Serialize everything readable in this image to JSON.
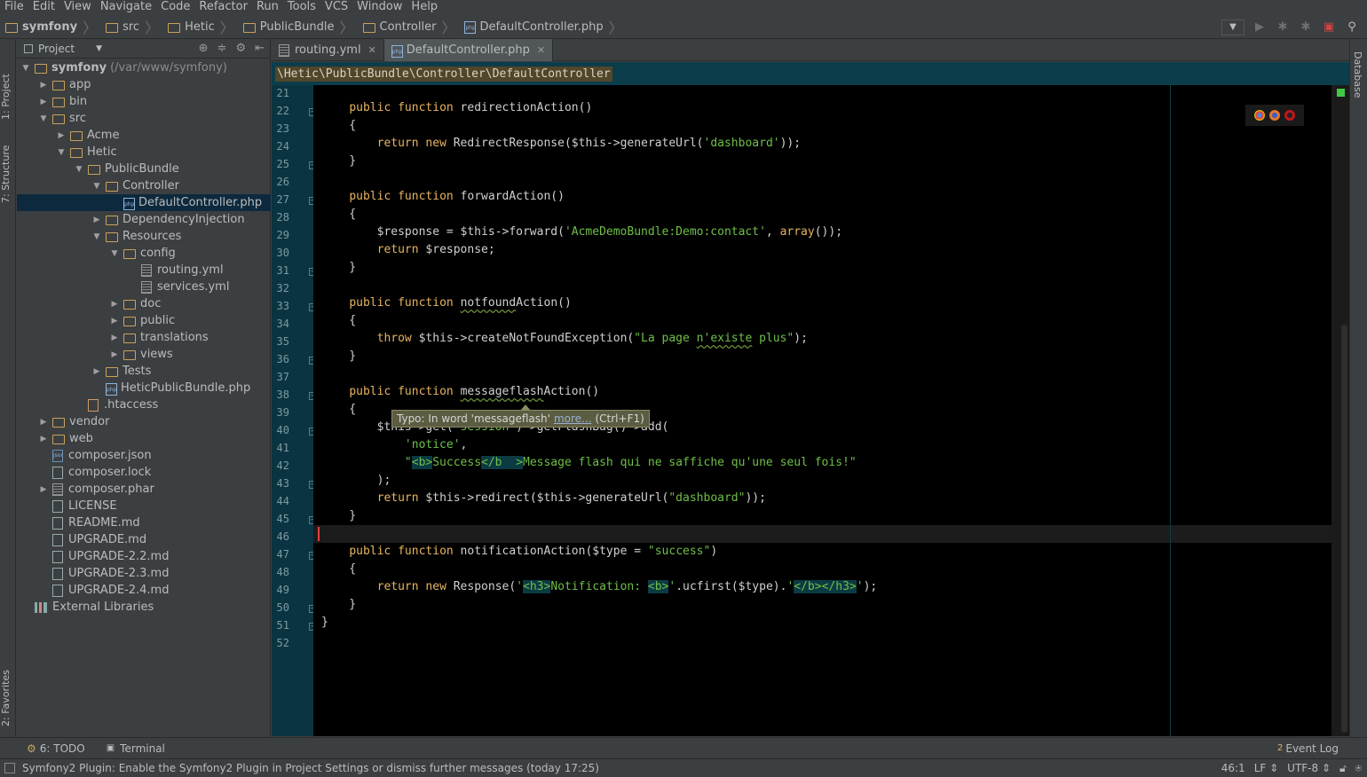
{
  "menu": [
    "File",
    "Edit",
    "View",
    "Navigate",
    "Code",
    "Refactor",
    "Run",
    "Tools",
    "VCS",
    "Window",
    "Help"
  ],
  "navbar": {
    "crumbs": [
      "symfony",
      "src",
      "Hetic",
      "PublicBundle",
      "Controller",
      "DefaultController.php"
    ]
  },
  "left_tool_tabs": {
    "project": "1: Project",
    "structure": "7: Structure",
    "favorites": "2: Favorites"
  },
  "project_panel": {
    "title": "Project",
    "tree": [
      {
        "label": "symfony",
        "suffix": "(/var/www/symfony)",
        "level": 0,
        "type": "folder",
        "arrow": "down",
        "bold": true
      },
      {
        "label": "app",
        "level": 1,
        "type": "folder",
        "arrow": "right"
      },
      {
        "label": "bin",
        "level": 1,
        "type": "folder",
        "arrow": "right"
      },
      {
        "label": "src",
        "level": 1,
        "type": "folder",
        "arrow": "down"
      },
      {
        "label": "Acme",
        "level": 2,
        "type": "folder",
        "arrow": "right"
      },
      {
        "label": "Hetic",
        "level": 2,
        "type": "folder",
        "arrow": "down"
      },
      {
        "label": "PublicBundle",
        "level": 3,
        "type": "folder",
        "arrow": "down"
      },
      {
        "label": "Controller",
        "level": 4,
        "type": "folder",
        "arrow": "down"
      },
      {
        "label": "DefaultController.php",
        "level": 5,
        "type": "php",
        "arrow": "none",
        "selected": true
      },
      {
        "label": "DependencyInjection",
        "level": 4,
        "type": "folder",
        "arrow": "right"
      },
      {
        "label": "Resources",
        "level": 4,
        "type": "folder",
        "arrow": "down"
      },
      {
        "label": "config",
        "level": 5,
        "type": "folder",
        "arrow": "down"
      },
      {
        "label": "routing.yml",
        "level": 6,
        "type": "yml",
        "arrow": "none"
      },
      {
        "label": "services.yml",
        "level": 6,
        "type": "yml",
        "arrow": "none"
      },
      {
        "label": "doc",
        "level": 5,
        "type": "folder",
        "arrow": "right"
      },
      {
        "label": "public",
        "level": 5,
        "type": "folder",
        "arrow": "right"
      },
      {
        "label": "translations",
        "level": 5,
        "type": "folder",
        "arrow": "right"
      },
      {
        "label": "views",
        "level": 5,
        "type": "folder",
        "arrow": "right"
      },
      {
        "label": "Tests",
        "level": 4,
        "type": "folder",
        "arrow": "right"
      },
      {
        "label": "HeticPublicBundle.php",
        "level": 4,
        "type": "php",
        "arrow": "none"
      },
      {
        "label": ".htaccess",
        "level": 3,
        "type": "htaccess",
        "arrow": "none"
      },
      {
        "label": "vendor",
        "level": 1,
        "type": "folder",
        "arrow": "right"
      },
      {
        "label": "web",
        "level": 1,
        "type": "folder",
        "arrow": "right"
      },
      {
        "label": "composer.json",
        "level": 1,
        "type": "json",
        "arrow": "none"
      },
      {
        "label": "composer.lock",
        "level": 1,
        "type": "file",
        "arrow": "none"
      },
      {
        "label": "composer.phar",
        "level": 1,
        "type": "yml",
        "arrow": "right"
      },
      {
        "label": "LICENSE",
        "level": 1,
        "type": "file",
        "arrow": "none"
      },
      {
        "label": "README.md",
        "level": 1,
        "type": "file",
        "arrow": "none"
      },
      {
        "label": "UPGRADE.md",
        "level": 1,
        "type": "file",
        "arrow": "none"
      },
      {
        "label": "UPGRADE-2.2.md",
        "level": 1,
        "type": "file",
        "arrow": "none"
      },
      {
        "label": "UPGRADE-2.3.md",
        "level": 1,
        "type": "file",
        "arrow": "none"
      },
      {
        "label": "UPGRADE-2.4.md",
        "level": 1,
        "type": "file",
        "arrow": "none"
      },
      {
        "label": "External Libraries",
        "level": 0,
        "type": "lib",
        "arrow": "none"
      }
    ]
  },
  "editor_tabs": [
    {
      "label": "routing.yml",
      "active": false
    },
    {
      "label": "DefaultController.php",
      "active": true
    }
  ],
  "editor_breadcrumb": "\\Hetic\\PublicBundle\\Controller\\DefaultController",
  "code_lines": [
    {
      "n": 21,
      "t": ""
    },
    {
      "n": 22,
      "t": "    public function redirectionAction()"
    },
    {
      "n": 23,
      "t": "    {"
    },
    {
      "n": 24,
      "t": "        return new RedirectResponse($this->generateUrl('dashboard'));"
    },
    {
      "n": 25,
      "t": "    }"
    },
    {
      "n": 26,
      "t": ""
    },
    {
      "n": 27,
      "t": "    public function forwardAction()"
    },
    {
      "n": 28,
      "t": "    {"
    },
    {
      "n": 29,
      "t": "        $response = $this->forward('AcmeDemoBundle:Demo:contact', array());"
    },
    {
      "n": 30,
      "t": "        return $response;"
    },
    {
      "n": 31,
      "t": "    }"
    },
    {
      "n": 32,
      "t": ""
    },
    {
      "n": 33,
      "t": "    public function notfoundAction()"
    },
    {
      "n": 34,
      "t": "    {"
    },
    {
      "n": 35,
      "t": "        throw $this->createNotFoundException(\"La page n'existe plus\");"
    },
    {
      "n": 36,
      "t": "    }"
    },
    {
      "n": 37,
      "t": ""
    },
    {
      "n": 38,
      "t": "    public function messageflashAction()"
    },
    {
      "n": 39,
      "t": "    {"
    },
    {
      "n": 40,
      "t": "        $this->get('session')->getFlashBag()->add("
    },
    {
      "n": 41,
      "t": "            'notice',"
    },
    {
      "n": 42,
      "t": "            \"<b>Success</b  >Message flash qui ne saffiche qu'une seul fois!\""
    },
    {
      "n": 43,
      "t": "        );"
    },
    {
      "n": 44,
      "t": "        return $this->redirect($this->generateUrl(\"dashboard\"));"
    },
    {
      "n": 45,
      "t": "    }"
    },
    {
      "n": 46,
      "t": ""
    },
    {
      "n": 47,
      "t": "    public function notificationAction($type = \"success\")"
    },
    {
      "n": 48,
      "t": "    {"
    },
    {
      "n": 49,
      "t": "        return new Response('<h3>Notification: <b>'.ucfirst($type).'</b></h3>');"
    },
    {
      "n": 50,
      "t": "    }"
    },
    {
      "n": 51,
      "t": "}"
    },
    {
      "n": 52,
      "t": ""
    }
  ],
  "tooltip": {
    "prefix": "Typo: In word 'messageflash'",
    "link": "more...",
    "shortcut": "(Ctrl+F1)"
  },
  "right_tool_tab": "Database",
  "bottom_tools": {
    "todo": "6: TODO",
    "terminal": "Terminal",
    "event_log": "Event Log",
    "event_count": "2"
  },
  "status": {
    "message": "Symfony2 Plugin: Enable the Symfony2 Plugin in Project Settings or dismiss further messages (today 17:25)",
    "position": "46:1",
    "line_sep": "LF",
    "encoding": "UTF-8"
  },
  "colors": {
    "keyword": "#e6b460",
    "string": "#6fbf48",
    "selection": "#0d293e",
    "gutter": "#0a3441"
  }
}
